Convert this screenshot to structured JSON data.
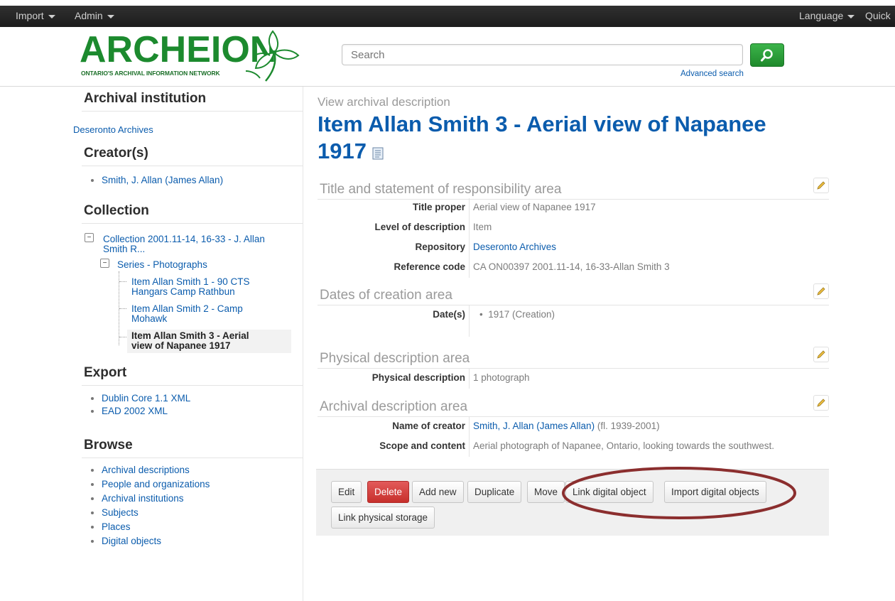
{
  "topnav": {
    "import_label": "Import",
    "admin_label": "Admin",
    "language_label": "Language",
    "quick_label": "Quick"
  },
  "header": {
    "logo_text": "ARCHEION",
    "logo_subtext": "ONTARIO'S ARCHIVAL INFORMATION NETWORK",
    "search_placeholder": "Search",
    "advanced_search": "Advanced search"
  },
  "sidebar": {
    "institution_heading": "Archival institution",
    "institution_link": "Deseronto Archives",
    "creators_heading": "Creator(s)",
    "creators": [
      "Smith, J. Allan (James Allan)"
    ],
    "collection_heading": "Collection",
    "tree": {
      "collection_line1": "Collection 2001.11-14, 16-33 - J. Allan",
      "collection_line2": "Smith R...",
      "series": "Series - Photographs",
      "item1_line1": "Item Allan Smith 1 - 90 CTS",
      "item1_line2": "Hangars Camp Rathbun",
      "item2_line1": "Item Allan Smith 2 - Camp",
      "item2_line2": "Mohawk",
      "item3_line1": "Item Allan Smith 3 - Aerial",
      "item3_line2": "view of Napanee 1917"
    },
    "export_heading": "Export",
    "export_items": [
      "Dublin Core 1.1 XML",
      "EAD 2002 XML"
    ],
    "browse_heading": "Browse",
    "browse_items": [
      "Archival descriptions",
      "People and organizations",
      "Archival institutions",
      "Subjects",
      "Places",
      "Digital objects"
    ]
  },
  "main": {
    "breadcrumb": "View archival description",
    "title_line1": "Item Allan Smith 3 - Aerial view of Napanee",
    "title_line2": "1917",
    "sections": {
      "title_area": {
        "heading": "Title and statement of responsibility area",
        "title_proper_label": "Title proper",
        "title_proper_value": "Aerial view of Napanee 1917",
        "level_label": "Level of description",
        "level_value": "Item",
        "repository_label": "Repository",
        "repository_value": "Deseronto Archives",
        "refcode_label": "Reference code",
        "refcode_value": "CA ON00397 2001.11-14, 16-33-Allan Smith 3"
      },
      "dates_area": {
        "heading": "Dates of creation area",
        "dates_label": "Date(s)",
        "dates_value": "1917 (Creation)"
      },
      "physical_area": {
        "heading": "Physical description area",
        "physical_label": "Physical description",
        "physical_value": "1 photograph"
      },
      "archival_area": {
        "heading": "Archival description area",
        "creator_label": "Name of creator",
        "creator_link": "Smith, J. Allan (James Allan)",
        "creator_dates": "(fl. 1939-2001)",
        "scope_label": "Scope and content",
        "scope_value": "Aerial photograph of Napanee, Ontario, looking towards the southwest."
      }
    },
    "actions": {
      "edit": "Edit",
      "delete": "Delete",
      "add_new": "Add new",
      "duplicate": "Duplicate",
      "move": "Move",
      "link_digital_object": "Link digital object",
      "import_digital_objects": "Import digital objects",
      "link_physical_storage": "Link physical storage"
    }
  },
  "colors": {
    "link": "#0b5cad",
    "logo_green": "#1c8a2e",
    "delete_red": "#c7302c",
    "annotation": "#8b2e2e"
  }
}
